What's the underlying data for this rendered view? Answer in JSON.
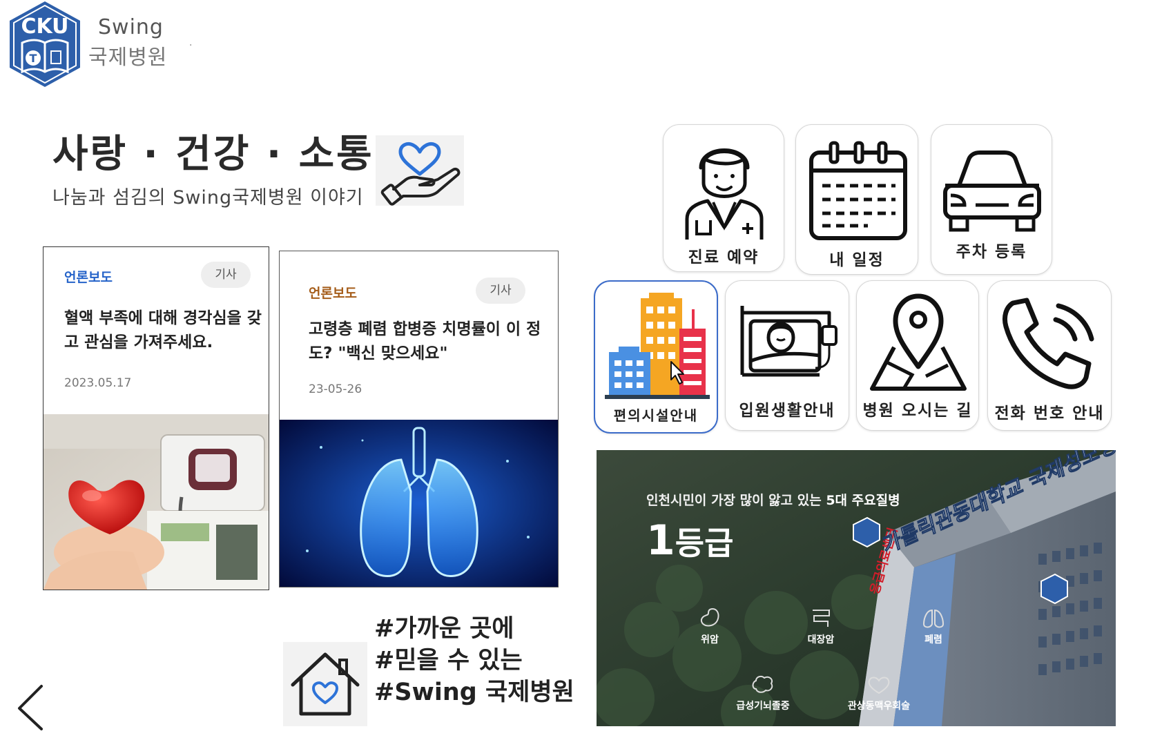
{
  "brand": {
    "logo_text": "CKU",
    "logo_letter": "T",
    "name": "Swing",
    "sub": "국제병원",
    "dot": "·"
  },
  "hero": {
    "headline": "사랑 · 건강 · 소통",
    "subline": "나눔과 섬김의 Swing국제병원 이야기"
  },
  "news": [
    {
      "category": "언론보도",
      "tag": "기사",
      "title": "혈액 부족에 대해 경각심을 갖고 관심을 가져주세요.",
      "date": "2023.05.17",
      "image": "blood-donation-heart-photo"
    },
    {
      "category": "언론보도",
      "tag": "기사",
      "title": "고령층 폐렴 합병증 치명률이 이 정도? \"백신 맞으세요\"",
      "date": "23-05-26",
      "image": "lungs-xray-photo"
    }
  ],
  "tagline": {
    "line1": "#가까운 곳에",
    "line2": "#믿을 수 있는",
    "line3": "#Swing 국제병원"
  },
  "menu": {
    "row1": [
      {
        "label": "진료 예약",
        "icon": "doctor-icon"
      },
      {
        "label": "내 일정",
        "icon": "calendar-icon"
      },
      {
        "label": "주차 등록",
        "icon": "car-icon"
      }
    ],
    "row2": [
      {
        "label": "편의시설안내",
        "icon": "buildings-icon"
      },
      {
        "label": "입원생활안내",
        "icon": "hospital-bed-icon"
      },
      {
        "label": "병원 오시는 길",
        "icon": "map-pin-icon"
      },
      {
        "label": "전화 번호 안내",
        "icon": "phone-icon"
      }
    ]
  },
  "banner": {
    "text_prefix": "인천시민이 가장 많이 앓고 있는 ",
    "text_bold": "5대 주요질병",
    "grade_num": "1",
    "grade_text": "등급",
    "diseases": [
      "위암",
      "대장암",
      "폐렴",
      "급성기뇌졸중",
      "관상동맥우회술"
    ],
    "building_sign": "가톨릭관동대학교 국제성모병원",
    "side_sign": "응급의료센터"
  },
  "colors": {
    "accent_blue": "#2563c9",
    "brown": "#a55d1a",
    "logo_blue": "#2d5faa"
  }
}
